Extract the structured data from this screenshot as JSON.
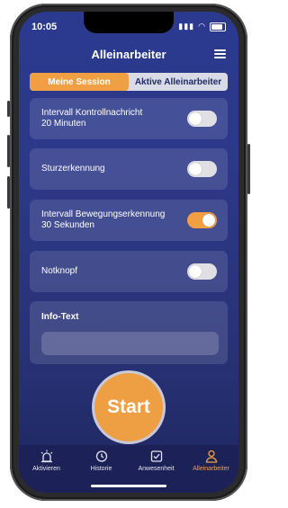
{
  "status": {
    "time": "10:05"
  },
  "header": {
    "title": "Alleinarbeiter"
  },
  "segments": {
    "left": "Meine Session",
    "right": "Aktive Alleinarbeiter",
    "selected": "left"
  },
  "settings": [
    {
      "label_line1": "Intervall Kontrollnachricht",
      "label_line2": "20 Minuten",
      "toggle_on": false
    },
    {
      "label_line1": "Sturzerkennung",
      "label_line2": "",
      "toggle_on": false
    },
    {
      "label_line1": "Intervall Bewegungserkennung",
      "label_line2": "30 Sekunden",
      "toggle_on": true
    },
    {
      "label_line1": "Notknopf",
      "label_line2": "",
      "toggle_on": false
    }
  ],
  "info": {
    "title": "Info-Text",
    "value": ""
  },
  "start_label": "Start",
  "tabs": [
    {
      "label": "Aktivieren",
      "icon": "alarm-icon"
    },
    {
      "label": "Historie",
      "icon": "history-icon"
    },
    {
      "label": "Anwesenheit",
      "icon": "checkbox-icon"
    },
    {
      "label": "Alleinarbeiter",
      "icon": "person-icon",
      "active": true
    }
  ],
  "colors": {
    "accent": "#f0a043",
    "background": "#2b3a8f",
    "tabbar": "#1c2257"
  }
}
